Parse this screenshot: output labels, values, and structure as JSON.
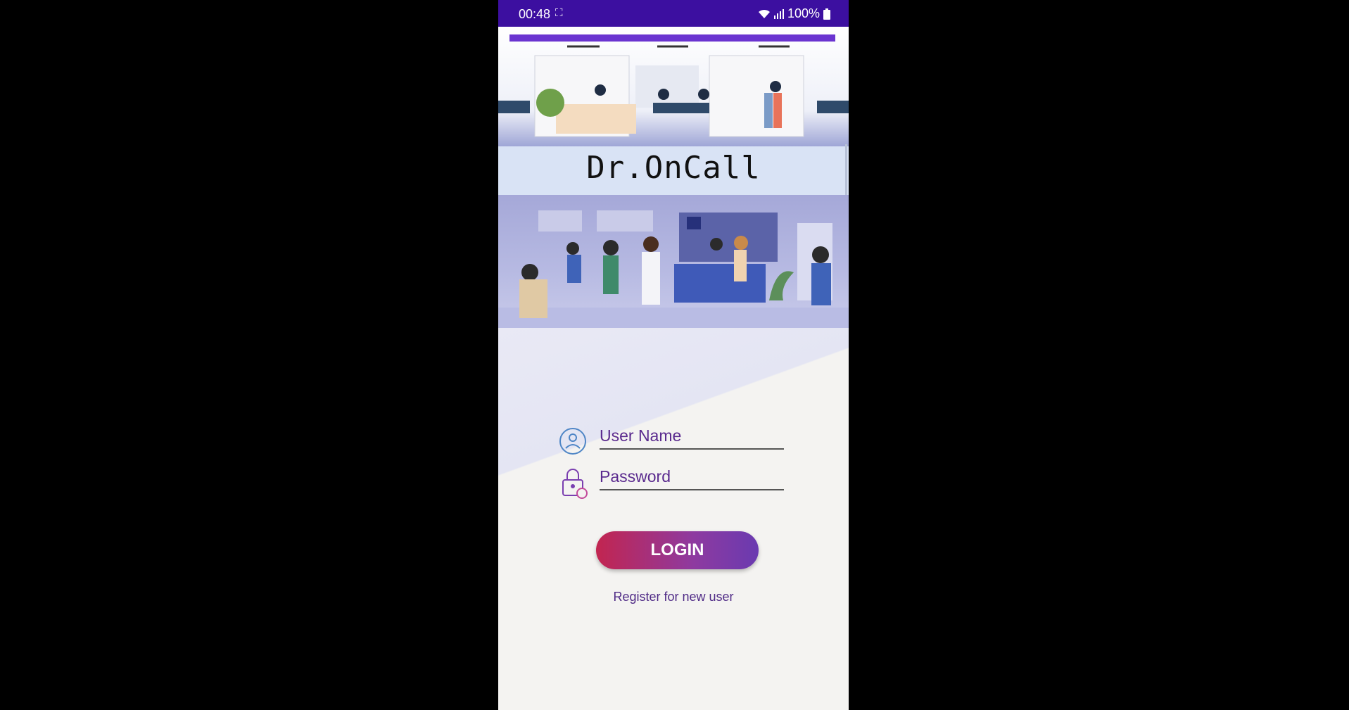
{
  "status_bar": {
    "time": "00:48",
    "battery": "100%",
    "icons": [
      "screenshot-icon",
      "wifi-icon",
      "signal-icon",
      "battery-icon"
    ]
  },
  "app": {
    "title": "Dr.OnCall"
  },
  "login_form": {
    "username_placeholder": "User Name",
    "password_placeholder": "Password",
    "login_label": "LOGIN",
    "register_label": "Register for new user"
  },
  "colors": {
    "status_bar": "#3c0fa0",
    "accent": "#6a34d0",
    "button_start": "#c22550",
    "button_end": "#6a3ab0",
    "input_text": "#5a2a8e"
  }
}
